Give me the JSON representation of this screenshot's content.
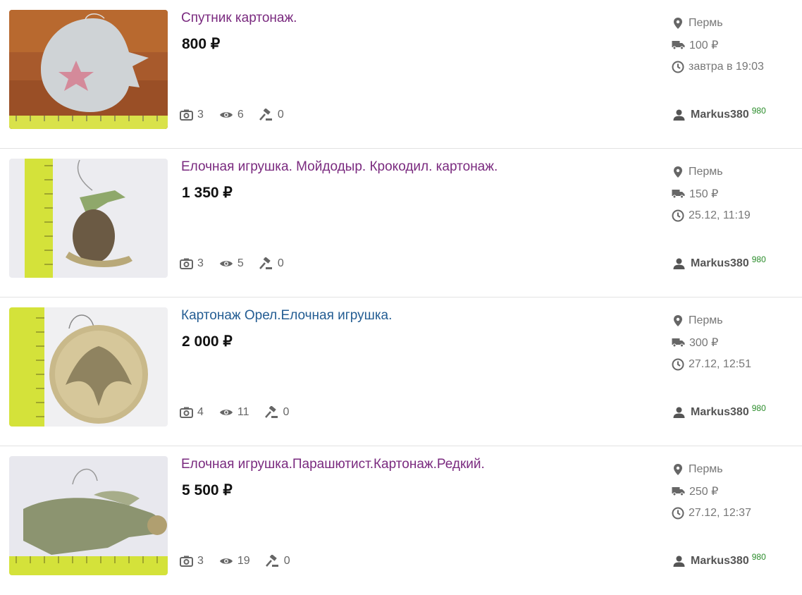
{
  "listings": [
    {
      "title": "Спутник картонаж.",
      "price": "800 ₽",
      "photos": "3",
      "views": "6",
      "bids": "0",
      "city": "Пермь",
      "shipping": "100 ₽",
      "ends": "завтра в 19:03",
      "seller": "Markus380",
      "rating": "980",
      "visited": true
    },
    {
      "title": "Елочная игрушка. Мойдодыр. Крокодил. картонаж.",
      "price": "1 350 ₽",
      "photos": "3",
      "views": "5",
      "bids": "0",
      "city": "Пермь",
      "shipping": "150 ₽",
      "ends": "25.12, 11:19",
      "seller": "Markus380",
      "rating": "980",
      "visited": true
    },
    {
      "title": "Картонаж Орел.Елочная игрушка.",
      "price": "2 000 ₽",
      "photos": "4",
      "views": "11",
      "bids": "0",
      "city": "Пермь",
      "shipping": "300 ₽",
      "ends": "27.12, 12:51",
      "seller": "Markus380",
      "rating": "980",
      "visited": false
    },
    {
      "title": "Елочная игрушка.Парашютист.Картонаж.Редкий.",
      "price": "5 500 ₽",
      "photos": "3",
      "views": "19",
      "bids": "0",
      "city": "Пермь",
      "shipping": "250 ₽",
      "ends": "27.12, 12:37",
      "seller": "Markus380",
      "rating": "980",
      "visited": true
    }
  ],
  "icons": {
    "photos": "camera-icon",
    "views": "eye-icon",
    "bids": "gavel-icon",
    "city": "location-pin-icon",
    "shipping": "truck-icon",
    "ends": "clock-icon",
    "seller": "user-icon"
  },
  "colors": {
    "title_visited": "#7a2a7f",
    "title_unvisited": "#245d93",
    "rating": "#2a8c2a"
  }
}
